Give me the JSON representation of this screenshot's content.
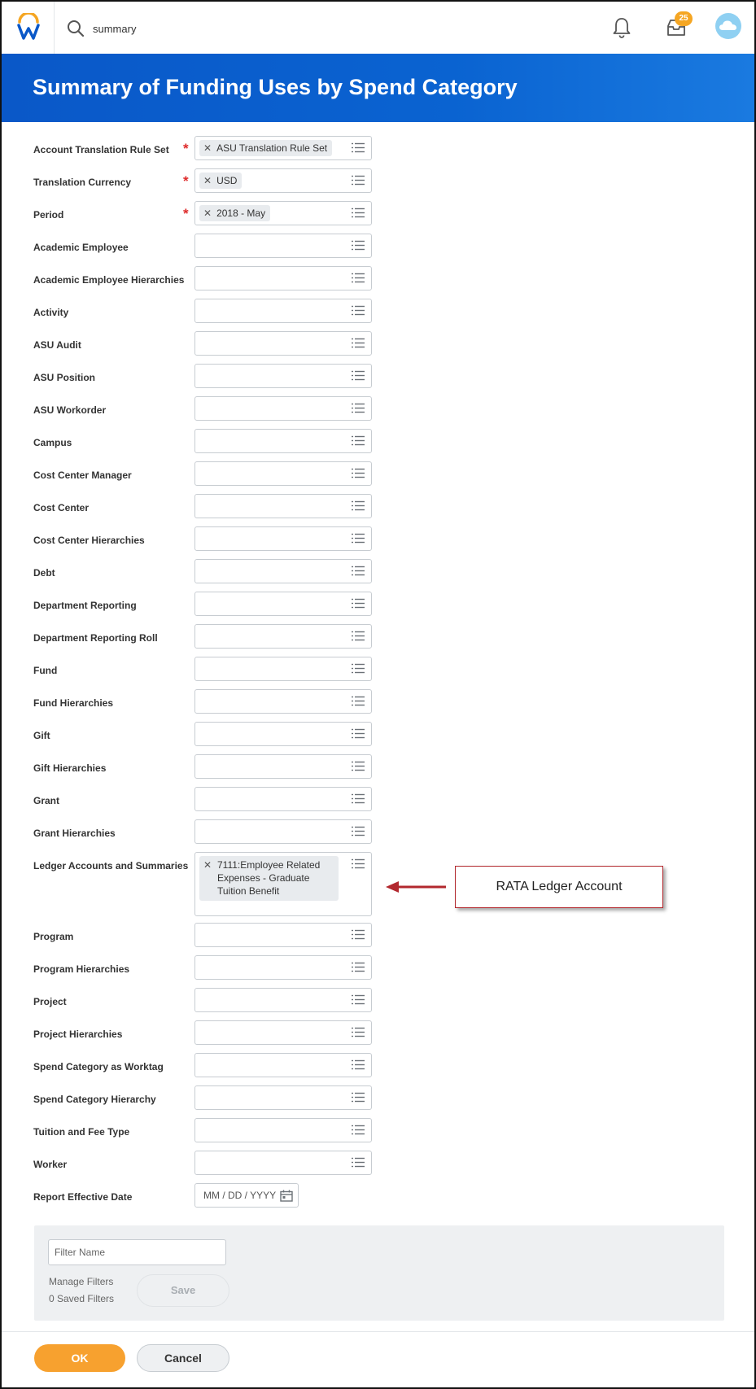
{
  "top_bar": {
    "search_value": "summary",
    "inbox_badge": "25",
    "icons": [
      "workday-logo-icon",
      "search-icon",
      "bell-icon",
      "inbox-icon",
      "cloud-avatar"
    ]
  },
  "header": {
    "title": "Summary of Funding Uses by Spend Category"
  },
  "form": {
    "fields": [
      {
        "label": "Account Translation Rule Set",
        "required": true,
        "value": "ASU Translation Rule Set"
      },
      {
        "label": "Translation Currency",
        "required": true,
        "value": "USD"
      },
      {
        "label": "Period",
        "required": true,
        "value": "2018 - May"
      },
      {
        "label": "Academic Employee",
        "value": ""
      },
      {
        "label": "Academic Employee Hierarchies",
        "value": ""
      },
      {
        "label": "Activity",
        "value": ""
      },
      {
        "label": "ASU Audit",
        "value": ""
      },
      {
        "label": "ASU Position",
        "value": ""
      },
      {
        "label": "ASU Workorder",
        "value": ""
      },
      {
        "label": "Campus",
        "value": ""
      },
      {
        "label": "Cost Center Manager",
        "value": ""
      },
      {
        "label": "Cost Center",
        "value": ""
      },
      {
        "label": "Cost Center Hierarchies",
        "value": ""
      },
      {
        "label": "Debt",
        "value": ""
      },
      {
        "label": "Department Reporting",
        "value": ""
      },
      {
        "label": "Department Reporting Roll",
        "value": ""
      },
      {
        "label": "Fund",
        "value": ""
      },
      {
        "label": "Fund Hierarchies",
        "value": ""
      },
      {
        "label": "Gift",
        "value": ""
      },
      {
        "label": "Gift Hierarchies",
        "value": ""
      },
      {
        "label": "Grant",
        "value": ""
      },
      {
        "label": "Grant Hierarchies",
        "value": ""
      },
      {
        "label": "Ledger Accounts and Summaries",
        "value": "7111:Employee Related Expenses - Graduate Tuition Benefit"
      },
      {
        "label": "Program",
        "value": ""
      },
      {
        "label": "Program Hierarchies",
        "value": ""
      },
      {
        "label": "Project",
        "value": ""
      },
      {
        "label": "Project Hierarchies",
        "value": ""
      },
      {
        "label": "Spend Category as Worktag",
        "value": ""
      },
      {
        "label": "Spend Category Hierarchy",
        "value": ""
      },
      {
        "label": "Tuition and Fee Type",
        "value": ""
      },
      {
        "label": "Worker",
        "value": ""
      }
    ],
    "effective_date": {
      "label": "Report Effective Date",
      "placeholder": "MM / DD / YYYY"
    }
  },
  "callout": {
    "text": "RATA Ledger Account"
  },
  "filters": {
    "name_placeholder": "Filter Name",
    "manage_label": "Manage Filters",
    "saved_label": "0 Saved Filters",
    "save_label": "Save"
  },
  "footer": {
    "ok_label": "OK",
    "cancel_label": "Cancel"
  },
  "colors": {
    "header_blue": "#0a58c8",
    "ok_orange": "#f7a12f",
    "required_red": "#de2b2b",
    "badge_orange": "#f5a623"
  }
}
